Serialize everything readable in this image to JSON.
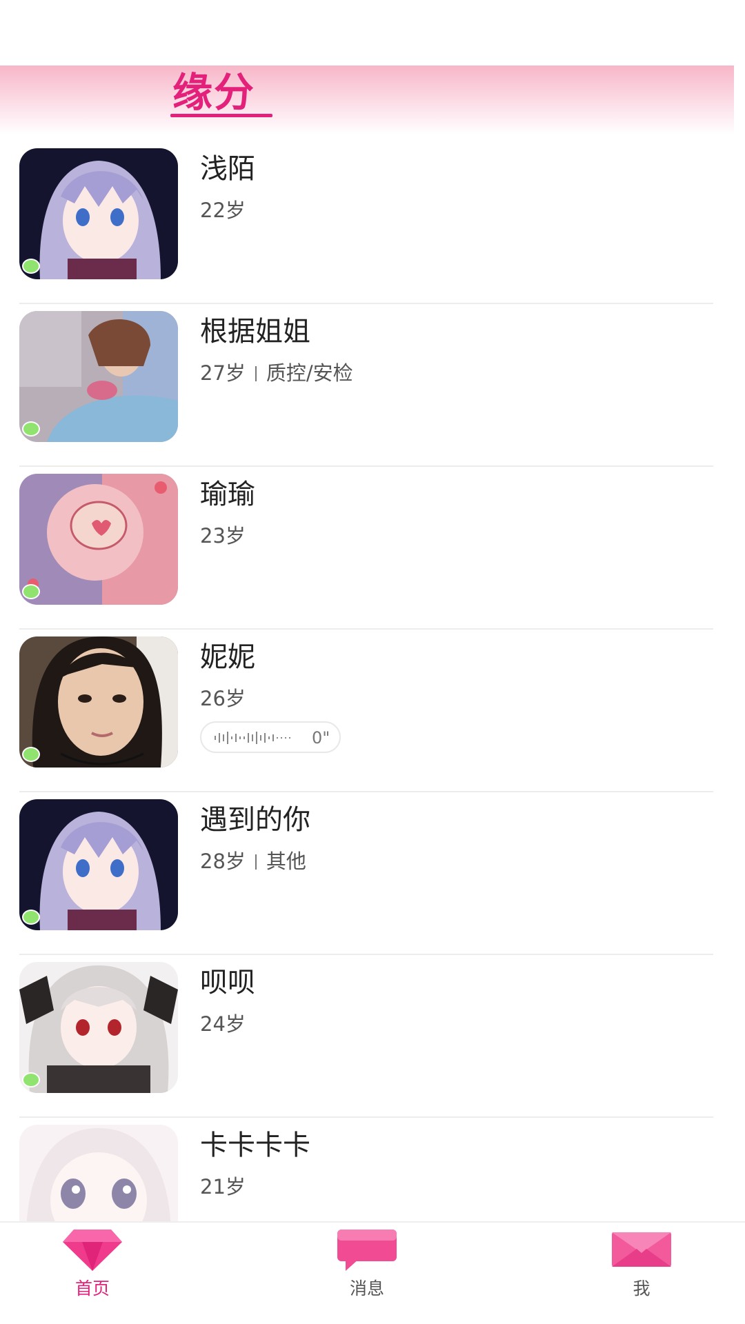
{
  "header": {
    "title": "缘分"
  },
  "users": [
    {
      "name": "浅陌",
      "age": "22岁",
      "job": "",
      "voice": ""
    },
    {
      "name": "根据姐姐",
      "age": "27岁",
      "job": "质控/安检",
      "voice": ""
    },
    {
      "name": "瑜瑜",
      "age": "23岁",
      "job": "",
      "voice": ""
    },
    {
      "name": "妮妮",
      "age": "26岁",
      "job": "",
      "voice": "0\""
    },
    {
      "name": "遇到的你",
      "age": "28岁",
      "job": "其他",
      "voice": ""
    },
    {
      "name": "呗呗",
      "age": "24岁",
      "job": "",
      "voice": ""
    },
    {
      "name": "卡卡卡卡",
      "age": "21岁",
      "job": "",
      "voice": ""
    }
  ],
  "tabbar": {
    "items": [
      {
        "label": "首页",
        "icon": "diamond-icon",
        "active": true
      },
      {
        "label": "消息",
        "icon": "chat-bubble-icon",
        "active": false
      },
      {
        "label": "我",
        "icon": "envelope-icon",
        "active": false
      }
    ]
  },
  "colors": {
    "accent": "#e3217a",
    "online": "#8fe36e",
    "header_pink": "#f7b6c8"
  }
}
